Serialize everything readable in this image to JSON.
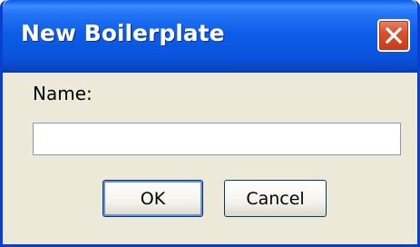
{
  "window": {
    "title": "New Boilerplate",
    "close_icon": "close-icon"
  },
  "form": {
    "name_label": "Name:",
    "name_value": "",
    "name_placeholder": ""
  },
  "buttons": {
    "ok_label": "OK",
    "cancel_label": "Cancel"
  },
  "colors": {
    "titlebar": "#0a55e0",
    "dialog_background": "#ece9d8",
    "close_button": "#d9522f"
  }
}
